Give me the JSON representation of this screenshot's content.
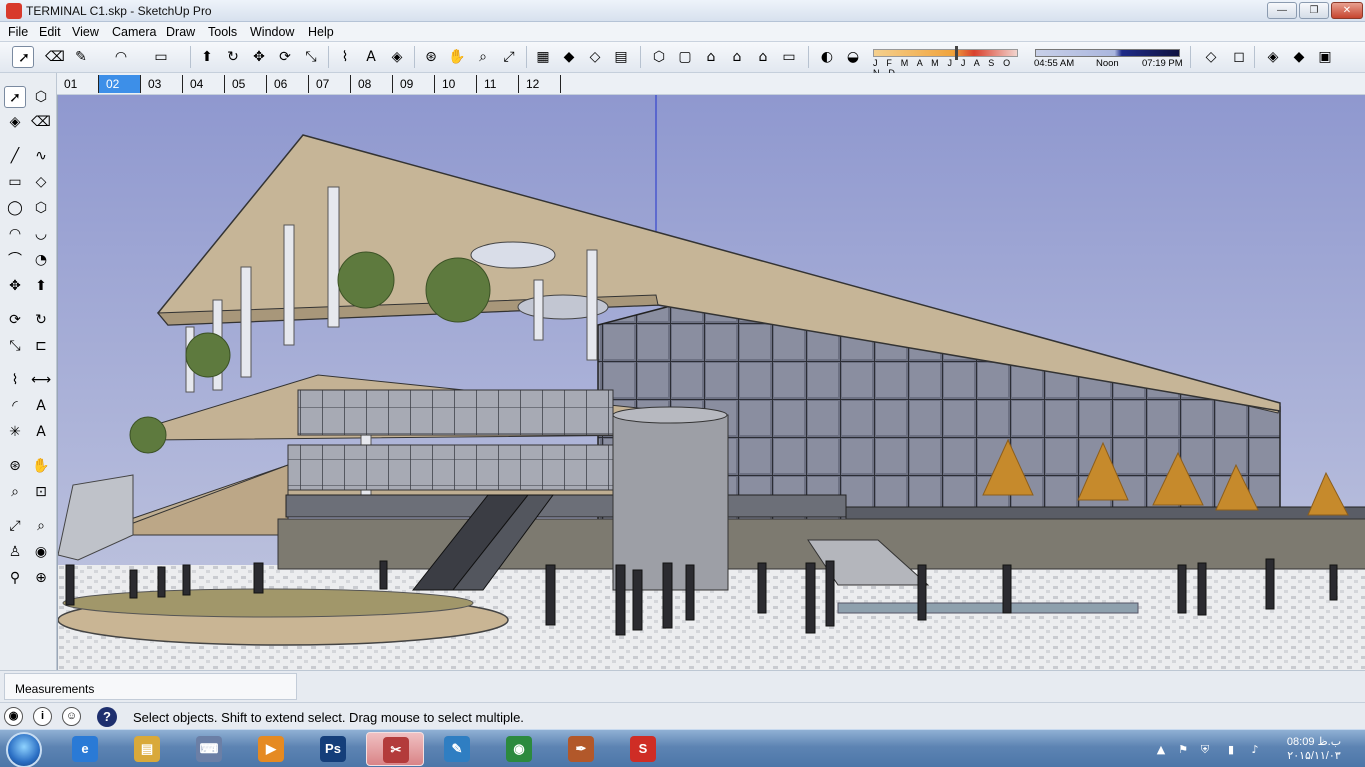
{
  "window": {
    "title": "TERMINAL C1.skp - SketchUp Pro",
    "controls": {
      "minimize": "—",
      "maximize": "❐",
      "close": "✕"
    }
  },
  "menu": [
    "File",
    "Edit",
    "View",
    "Camera",
    "Draw",
    "Tools",
    "Window",
    "Help"
  ],
  "toolbar": {
    "tools": [
      {
        "icon": "select-arrow-icon",
        "glyph": "➚"
      },
      {
        "icon": "eraser-icon",
        "glyph": "⌫"
      },
      {
        "icon": "pencil-icon",
        "glyph": "✎"
      },
      {
        "icon": "arc-icon",
        "glyph": "◠"
      },
      {
        "icon": "rectangle-icon",
        "glyph": "▭"
      },
      {
        "icon": "push-pull-icon",
        "glyph": "⬆"
      },
      {
        "icon": "follow-me-icon",
        "glyph": "↻"
      },
      {
        "icon": "move-icon",
        "glyph": "✥"
      },
      {
        "icon": "rotate-icon",
        "glyph": "⟳"
      },
      {
        "icon": "scale-icon",
        "glyph": "⤡"
      },
      {
        "icon": "tape-measure-icon",
        "glyph": "⌇"
      },
      {
        "icon": "text-icon",
        "glyph": "A"
      },
      {
        "icon": "paint-bucket-icon",
        "glyph": "◈"
      },
      {
        "icon": "orbit-icon",
        "glyph": "⊛"
      },
      {
        "icon": "pan-icon",
        "glyph": "✋"
      },
      {
        "icon": "zoom-icon",
        "glyph": "⌕"
      },
      {
        "icon": "zoom-extents-icon",
        "glyph": "⤢"
      },
      {
        "icon": "warehouse-icon",
        "glyph": "▦"
      },
      {
        "icon": "components-icon",
        "glyph": "◆"
      },
      {
        "icon": "extension-icon",
        "glyph": "◇"
      },
      {
        "icon": "layout-icon",
        "glyph": "▤"
      },
      {
        "icon": "iso-view-icon",
        "glyph": "⬡"
      },
      {
        "icon": "top-view-icon",
        "glyph": "▢"
      },
      {
        "icon": "front-view-icon",
        "glyph": "⌂"
      },
      {
        "icon": "right-view-icon",
        "glyph": "⌂"
      },
      {
        "icon": "back-view-icon",
        "glyph": "⌂"
      },
      {
        "icon": "left-view-icon",
        "glyph": "▭"
      },
      {
        "icon": "shadows-toggle-icon",
        "glyph": "◐"
      },
      {
        "icon": "fog-icon",
        "glyph": "◒"
      },
      {
        "icon": "xray-icon",
        "glyph": "◇"
      },
      {
        "icon": "wireframe-icon",
        "glyph": "◻"
      },
      {
        "icon": "hidden-line-icon",
        "glyph": "◈"
      },
      {
        "icon": "shaded-icon",
        "glyph": "◆"
      },
      {
        "icon": "shaded-textures-icon",
        "glyph": "▣"
      }
    ],
    "shadow_settings": {
      "months": "J F M A M J J A S O N D",
      "time_start": "04:55 AM",
      "time_noon": "Noon",
      "time_end": "07:19 PM"
    }
  },
  "scenes": [
    "01",
    "02",
    "03",
    "04",
    "05",
    "06",
    "07",
    "08",
    "09",
    "10",
    "11",
    "12"
  ],
  "active_scene": "02",
  "palette": [
    {
      "icon": "select-icon",
      "glyph": "➚",
      "active": true
    },
    {
      "icon": "make-component-icon",
      "glyph": "⬡"
    },
    {
      "icon": "paint-bucket-icon",
      "glyph": "◈"
    },
    {
      "icon": "eraser-icon",
      "glyph": "⌫"
    },
    {
      "icon": "line-icon",
      "glyph": "╱"
    },
    {
      "icon": "freehand-icon",
      "glyph": "∿"
    },
    {
      "icon": "rectangle-icon",
      "glyph": "▭"
    },
    {
      "icon": "rotated-rectangle-icon",
      "glyph": "◇"
    },
    {
      "icon": "circle-icon",
      "glyph": "◯"
    },
    {
      "icon": "polygon-icon",
      "glyph": "⬡"
    },
    {
      "icon": "arc-icon",
      "glyph": "◠"
    },
    {
      "icon": "two-point-arc-icon",
      "glyph": "◡"
    },
    {
      "icon": "three-point-arc-icon",
      "glyph": "⌒"
    },
    {
      "icon": "pie-icon",
      "glyph": "◔"
    },
    {
      "icon": "move-icon",
      "glyph": "✥"
    },
    {
      "icon": "push-pull-icon",
      "glyph": "⬆"
    },
    {
      "icon": "rotate-icon",
      "glyph": "⟳"
    },
    {
      "icon": "follow-me-icon",
      "glyph": "↻"
    },
    {
      "icon": "scale-icon",
      "glyph": "⤡"
    },
    {
      "icon": "offset-icon",
      "glyph": "⊏"
    },
    {
      "icon": "tape-measure-icon",
      "glyph": "⌇"
    },
    {
      "icon": "dimension-icon",
      "glyph": "⟷"
    },
    {
      "icon": "protractor-icon",
      "glyph": "◜"
    },
    {
      "icon": "text-icon",
      "glyph": "A"
    },
    {
      "icon": "axes-icon",
      "glyph": "✳"
    },
    {
      "icon": "3d-text-icon",
      "glyph": "A"
    },
    {
      "icon": "orbit-icon",
      "glyph": "⊛"
    },
    {
      "icon": "pan-icon",
      "glyph": "✋"
    },
    {
      "icon": "zoom-icon",
      "glyph": "⌕"
    },
    {
      "icon": "zoom-window-icon",
      "glyph": "⊡"
    },
    {
      "icon": "zoom-extents-icon",
      "glyph": "⤢"
    },
    {
      "icon": "previous-view-icon",
      "glyph": "⌕"
    },
    {
      "icon": "position-camera-icon",
      "glyph": "♙"
    },
    {
      "icon": "look-around-icon",
      "glyph": "◉"
    },
    {
      "icon": "walk-icon",
      "glyph": "⚲"
    },
    {
      "icon": "section-plane-icon",
      "glyph": "⊕"
    }
  ],
  "measurements": {
    "label": "Measurements"
  },
  "status": {
    "icons": {
      "geo": "◉",
      "info": "i",
      "user": "☺",
      "help": "?"
    },
    "text": "Select objects. Shift to extend select. Drag mouse to select multiple."
  },
  "taskbar": {
    "apps": [
      {
        "name": "internet-explorer",
        "glyph": "e",
        "color": "#2a7ad6"
      },
      {
        "name": "file-explorer",
        "glyph": "▤",
        "color": "#d9a93a"
      },
      {
        "name": "keyboard-app",
        "glyph": "⌨",
        "color": "#6b7fa6"
      },
      {
        "name": "media-player",
        "glyph": "▶",
        "color": "#e58a22"
      },
      {
        "name": "photoshop",
        "glyph": "Ps",
        "color": "#143e7a"
      },
      {
        "name": "active-tool-app",
        "glyph": "✂",
        "color": "#b33b3b"
      },
      {
        "name": "brush-app",
        "glyph": "✎",
        "color": "#2f7ec2"
      },
      {
        "name": "globe-app",
        "glyph": "◉",
        "color": "#2c8a3e"
      },
      {
        "name": "pen-app",
        "glyph": "✒",
        "color": "#b2582a"
      },
      {
        "name": "sketchup",
        "glyph": "S",
        "color": "#cf2d25"
      }
    ],
    "active_index": 5,
    "tray": {
      "show_hidden": "▲",
      "flag": "⚑",
      "security": "⛨",
      "signal": "▮",
      "volume": "♪"
    },
    "clock": {
      "time": "08:09 ب.ظ",
      "date": "۲۰۱۵/۱۱/۰۳"
    }
  }
}
